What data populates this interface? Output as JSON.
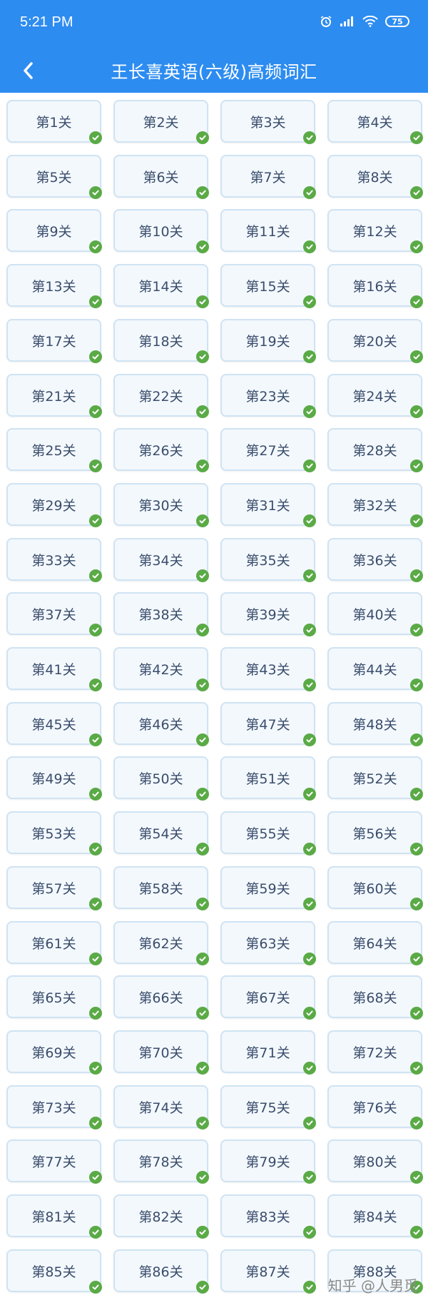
{
  "status": {
    "time": "5:21 PM",
    "battery": "75"
  },
  "header": {
    "title": "王长喜英语(六级)高频词汇"
  },
  "levels": [
    "第1关",
    "第2关",
    "第3关",
    "第4关",
    "第5关",
    "第6关",
    "第7关",
    "第8关",
    "第9关",
    "第10关",
    "第11关",
    "第12关",
    "第13关",
    "第14关",
    "第15关",
    "第16关",
    "第17关",
    "第18关",
    "第19关",
    "第20关",
    "第21关",
    "第22关",
    "第23关",
    "第24关",
    "第25关",
    "第26关",
    "第27关",
    "第28关",
    "第29关",
    "第30关",
    "第31关",
    "第32关",
    "第33关",
    "第34关",
    "第35关",
    "第36关",
    "第37关",
    "第38关",
    "第39关",
    "第40关",
    "第41关",
    "第42关",
    "第43关",
    "第44关",
    "第45关",
    "第46关",
    "第47关",
    "第48关",
    "第49关",
    "第50关",
    "第51关",
    "第52关",
    "第53关",
    "第54关",
    "第55关",
    "第56关",
    "第57关",
    "第58关",
    "第59关",
    "第60关",
    "第61关",
    "第62关",
    "第63关",
    "第64关",
    "第65关",
    "第66关",
    "第67关",
    "第68关",
    "第69关",
    "第70关",
    "第71关",
    "第72关",
    "第73关",
    "第74关",
    "第75关",
    "第76关",
    "第77关",
    "第78关",
    "第79关",
    "第80关",
    "第81关",
    "第82关",
    "第83关",
    "第84关",
    "第85关",
    "第86关",
    "第87关",
    "第88关"
  ],
  "level_status_icon": "check-circle-icon",
  "watermark": "知乎 @人男觅",
  "colors": {
    "header": "#2d8cf0",
    "check": "#5aaa46",
    "tile_border": "#cfe3f3"
  }
}
